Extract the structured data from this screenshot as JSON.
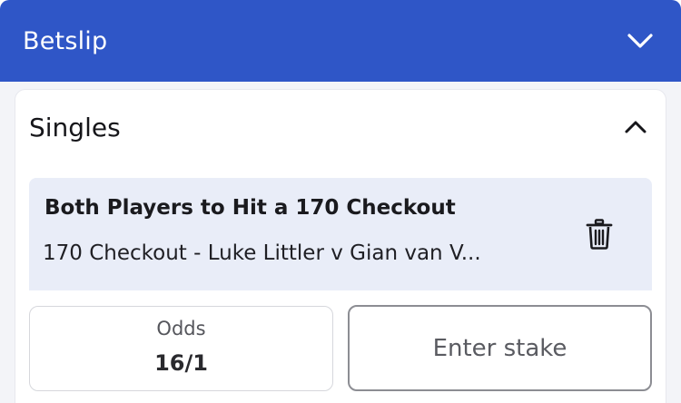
{
  "header": {
    "title": "Betslip",
    "chevron_icon": "chevron-down-icon",
    "background": "#2f56c7"
  },
  "section": {
    "title": "Singles",
    "chevron_icon": "chevron-up-icon"
  },
  "selection": {
    "name": "Both Players to Hit a 170 Checkout",
    "market": "170 Checkout - Luke Littler v Gian van V...",
    "delete_icon": "trash-icon",
    "background": "#e9edf8"
  },
  "odds": {
    "label": "Odds",
    "value": "16/1"
  },
  "stake": {
    "placeholder": "Enter stake",
    "value": ""
  }
}
